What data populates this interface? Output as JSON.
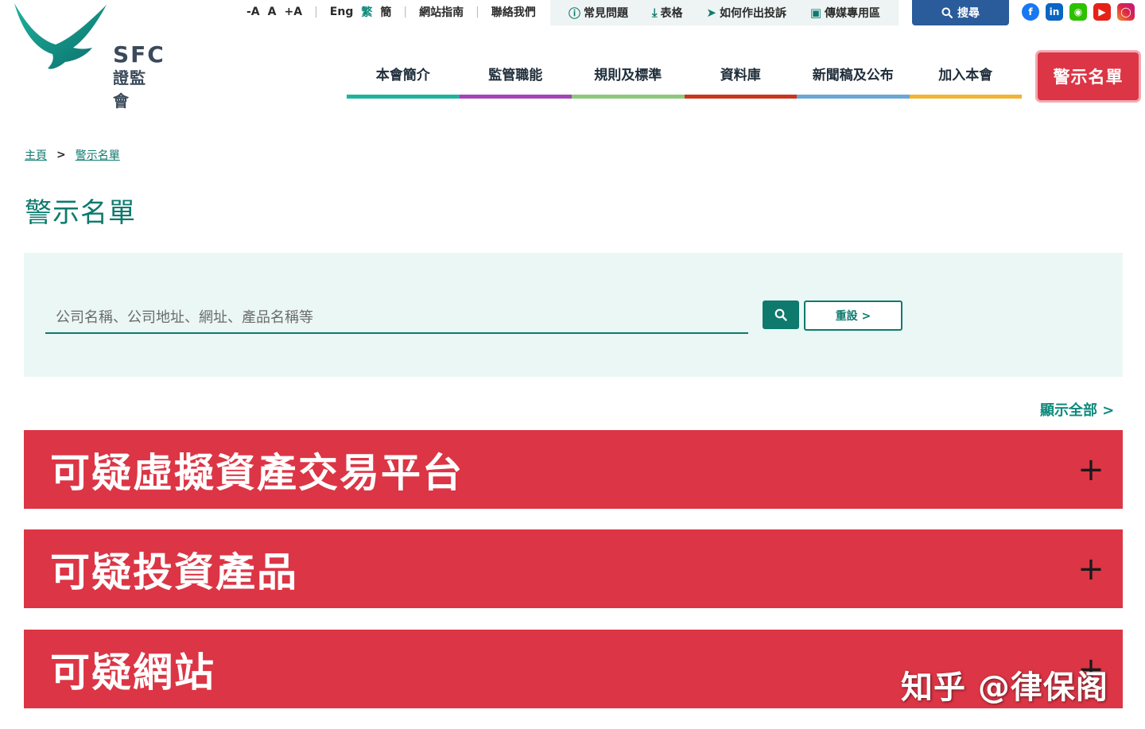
{
  "logo": {
    "en": "SFC",
    "zh": "證監會"
  },
  "utility": {
    "font_small": "-A",
    "font_normal": "A",
    "font_large": "+A",
    "lang_en": "Eng",
    "lang_tc": "繁",
    "lang_sc": "簡",
    "sitemap": "網站指南",
    "contact": "聯絡我們"
  },
  "quick_links": [
    {
      "label": "常見問題",
      "icon": "question-circle-icon"
    },
    {
      "label": "表格",
      "icon": "download-icon"
    },
    {
      "label": "如何作出投訴",
      "icon": "megaphone-icon"
    },
    {
      "label": "傳媒專用區",
      "icon": "image-icon"
    }
  ],
  "search_label": "搜尋",
  "social": [
    "facebook-icon",
    "linkedin-icon",
    "wechat-icon",
    "youtube-icon",
    "instagram-icon"
  ],
  "nav": [
    {
      "label": "本會簡介",
      "color": "#1fb39f"
    },
    {
      "label": "監管職能",
      "color": "#a543b8"
    },
    {
      "label": "規則及標準",
      "color": "#8cc97c"
    },
    {
      "label": "資料庫",
      "color": "#c9361d"
    },
    {
      "label": "新聞稿及公布",
      "color": "#6aa6d6"
    },
    {
      "label": "加入本會",
      "color": "#f2b432"
    }
  ],
  "alert_button": "警示名單",
  "breadcrumb": {
    "home": "主頁",
    "separator": ">",
    "current": "警示名單"
  },
  "page_title": "警示名單",
  "search": {
    "placeholder": "公司名稱、公司地址、網址、產品名稱等",
    "value": "",
    "reset_label": "重設 >"
  },
  "show_all": "顯示全部 >",
  "accordions": [
    {
      "title": "可疑虛擬資產交易平台",
      "expand": "+"
    },
    {
      "title": "可疑投資產品",
      "expand": "+"
    },
    {
      "title": "可疑網站",
      "expand": "+"
    }
  ],
  "watermark": "知乎 @律保阁",
  "colors": {
    "brand_teal": "#0d7a6d",
    "alert_red": "#dc3545",
    "search_blue": "#2a5b9a",
    "panel_bg": "#eaf7f5"
  }
}
